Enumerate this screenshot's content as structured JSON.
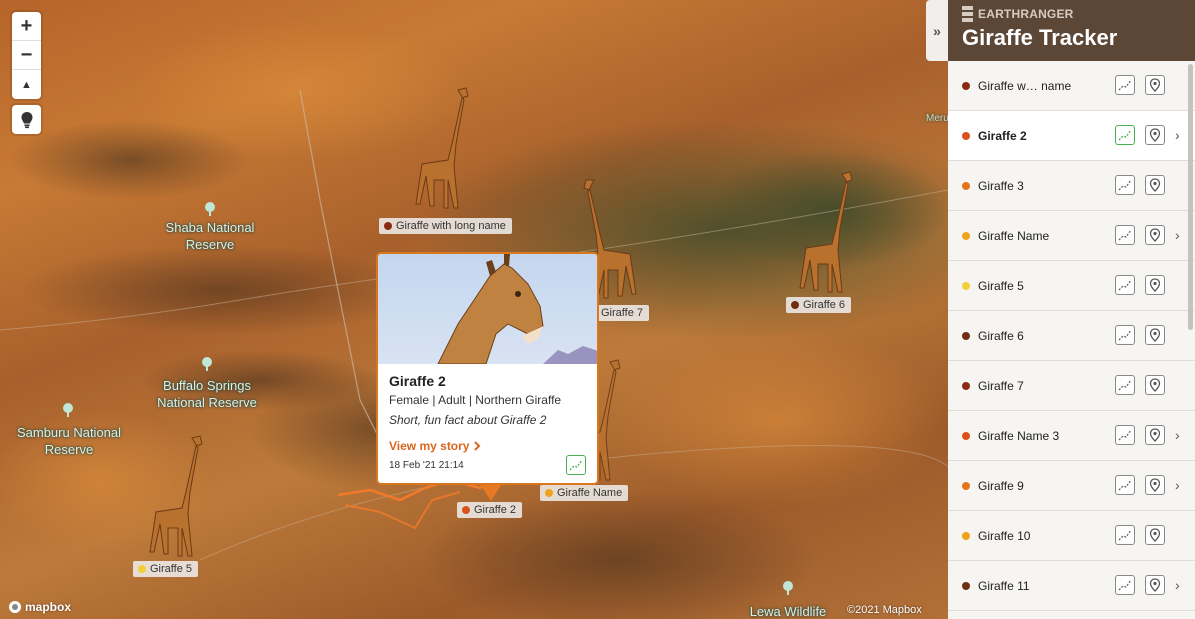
{
  "map": {
    "zoom_in": "+",
    "zoom_out": "−",
    "compass": "▲",
    "places": [
      {
        "name": "Shaba National\nReserve"
      },
      {
        "name": "Buffalo Springs\nNational Reserve"
      },
      {
        "name": "Samburu National\nReserve"
      },
      {
        "name": "Lewa Wildlife"
      },
      {
        "name": "Meru National Park"
      }
    ],
    "giraffe_labels": [
      {
        "name": "Giraffe with long name",
        "color": "#8b2a12"
      },
      {
        "name": "Giraffe 7",
        "color": ""
      },
      {
        "name": "Giraffe 6",
        "color": "#6e2e12"
      },
      {
        "name": "Giraffe Name",
        "color": "#f0a21c"
      },
      {
        "name": "Giraffe 2",
        "color": "#d9521b"
      },
      {
        "name": "Giraffe 5",
        "color": "#f5cf3a"
      }
    ],
    "attribution": "©2021 Mapbox",
    "logo": "mapbox"
  },
  "popup": {
    "title": "Giraffe 2",
    "meta": "Female | Adult | Northern Giraffe",
    "fact": "Short, fun fact about Giraffe 2",
    "story_link": "View my story",
    "timestamp": "18 Feb '21 21:14"
  },
  "sidebar": {
    "brand": "EARTHRANGER",
    "title": "Giraffe Tracker",
    "collapse": "»",
    "items": [
      {
        "name": "Giraffe w… name",
        "color": "#8b2a12",
        "chevron": false,
        "selected": false,
        "track_active": false
      },
      {
        "name": "Giraffe 2",
        "color": "#d9521b",
        "chevron": true,
        "selected": true,
        "track_active": true
      },
      {
        "name": "Giraffe 3",
        "color": "#e8731c",
        "chevron": false,
        "selected": false,
        "track_active": false
      },
      {
        "name": "Giraffe Name",
        "color": "#f0a21c",
        "chevron": true,
        "selected": false,
        "track_active": false
      },
      {
        "name": "Giraffe 5",
        "color": "#f5cf3a",
        "chevron": false,
        "selected": false,
        "track_active": false
      },
      {
        "name": "Giraffe 6",
        "color": "#6e2e12",
        "chevron": false,
        "selected": false,
        "track_active": false
      },
      {
        "name": "Giraffe 7",
        "color": "#8b2a12",
        "chevron": false,
        "selected": false,
        "track_active": false
      },
      {
        "name": "Giraffe Name 3",
        "color": "#d9521b",
        "chevron": true,
        "selected": false,
        "track_active": false
      },
      {
        "name": "Giraffe 9",
        "color": "#e8731c",
        "chevron": true,
        "selected": false,
        "track_active": false
      },
      {
        "name": "Giraffe 10",
        "color": "#f0a21c",
        "chevron": false,
        "selected": false,
        "track_active": false
      },
      {
        "name": "Giraffe 11",
        "color": "#6e2e12",
        "chevron": true,
        "selected": false,
        "track_active": false
      }
    ]
  }
}
